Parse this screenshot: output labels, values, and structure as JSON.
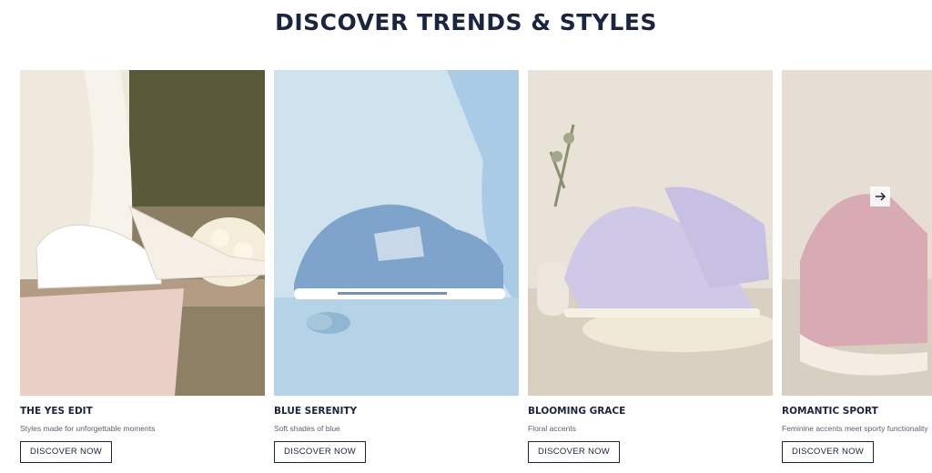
{
  "section": {
    "title": "DISCOVER TRENDS & STYLES"
  },
  "cards": [
    {
      "title": "THE YES EDIT",
      "subtitle": "Styles made for unforgettable moments",
      "button": "DISCOVER NOW"
    },
    {
      "title": "BLUE SERENITY",
      "subtitle": "Soft shades of blue",
      "button": "DISCOVER NOW"
    },
    {
      "title": "BLOOMING GRACE",
      "subtitle": "Floral accents",
      "button": "DISCOVER NOW"
    },
    {
      "title": "ROMANTIC SPORT",
      "subtitle": "Feminine accents meet sporty functionality",
      "button": "DISCOVER NOW"
    }
  ],
  "icons": {
    "next": "arrow-right-icon"
  }
}
